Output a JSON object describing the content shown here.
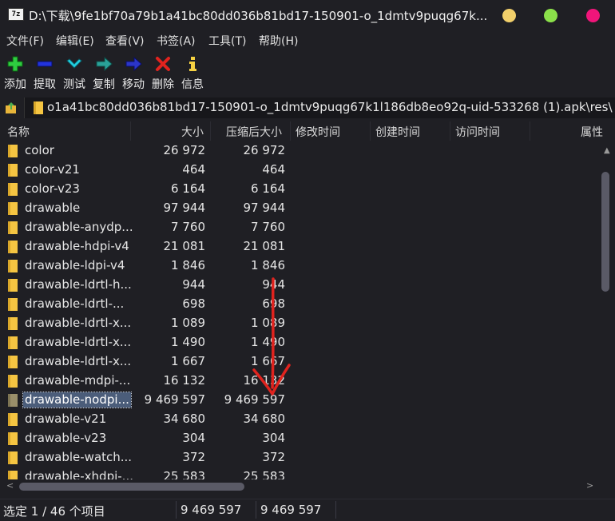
{
  "window": {
    "app_icon_text": "7z",
    "title": "D:\\下载\\9fe1bf70a79b1a41bc80dd036b81bd17-150901-o_1dmtv9puqg67k..."
  },
  "menu": {
    "items": [
      "文件(F)",
      "编辑(E)",
      "查看(V)",
      "书签(A)",
      "工具(T)",
      "帮助(H)"
    ]
  },
  "toolbar": {
    "add": "添加",
    "extract": "提取",
    "test": "测试",
    "copy": "复制",
    "move": "移动",
    "delete": "删除",
    "info": "信息"
  },
  "address": {
    "path": "o1a41bc80dd036b81bd17-150901-o_1dmtv9puqg67k1l186db8eo92q-uid-533268 (1).apk\\res\\"
  },
  "columns": {
    "name": "名称",
    "size": "大小",
    "packed_size": "压缩后大小",
    "modified": "修改时间",
    "created": "创建时间",
    "accessed": "访问时间",
    "attributes": "属性"
  },
  "files": [
    {
      "name": "color",
      "size": "26 972",
      "packed": "26 972"
    },
    {
      "name": "color-v21",
      "size": "464",
      "packed": "464"
    },
    {
      "name": "color-v23",
      "size": "6 164",
      "packed": "6 164"
    },
    {
      "name": "drawable",
      "size": "97 944",
      "packed": "97 944"
    },
    {
      "name": "drawable-anydp...",
      "size": "7 760",
      "packed": "7 760"
    },
    {
      "name": "drawable-hdpi-v4",
      "size": "21 081",
      "packed": "21 081"
    },
    {
      "name": "drawable-ldpi-v4",
      "size": "1 846",
      "packed": "1 846"
    },
    {
      "name": "drawable-ldrtl-h...",
      "size": "944",
      "packed": "944"
    },
    {
      "name": "drawable-ldrtl-...",
      "size": "698",
      "packed": "698"
    },
    {
      "name": "drawable-ldrtl-x...",
      "size": "1 089",
      "packed": "1 089"
    },
    {
      "name": "drawable-ldrtl-x...",
      "size": "1 490",
      "packed": "1 490"
    },
    {
      "name": "drawable-ldrtl-x...",
      "size": "1 667",
      "packed": "1 667"
    },
    {
      "name": "drawable-mdpi-...",
      "size": "16 132",
      "packed": "16 132"
    },
    {
      "name": "drawable-nodpi...",
      "size": "9 469 597",
      "packed": "9 469 597",
      "selected": true
    },
    {
      "name": "drawable-v21",
      "size": "34 680",
      "packed": "34 680"
    },
    {
      "name": "drawable-v23",
      "size": "304",
      "packed": "304"
    },
    {
      "name": "drawable-watch...",
      "size": "372",
      "packed": "372"
    },
    {
      "name": "drawable-xhdpi-...",
      "size": "25 583",
      "packed": "25 583"
    }
  ],
  "status": {
    "selection": "选定 1 / 46 个项目",
    "size": "9 469 597",
    "packed_size": "9 469 597"
  },
  "colors": {
    "background": "#1f1f24",
    "folder": "#f5c542",
    "selection": "#4b5d7a",
    "annotation_arrow": "#e0231e"
  }
}
